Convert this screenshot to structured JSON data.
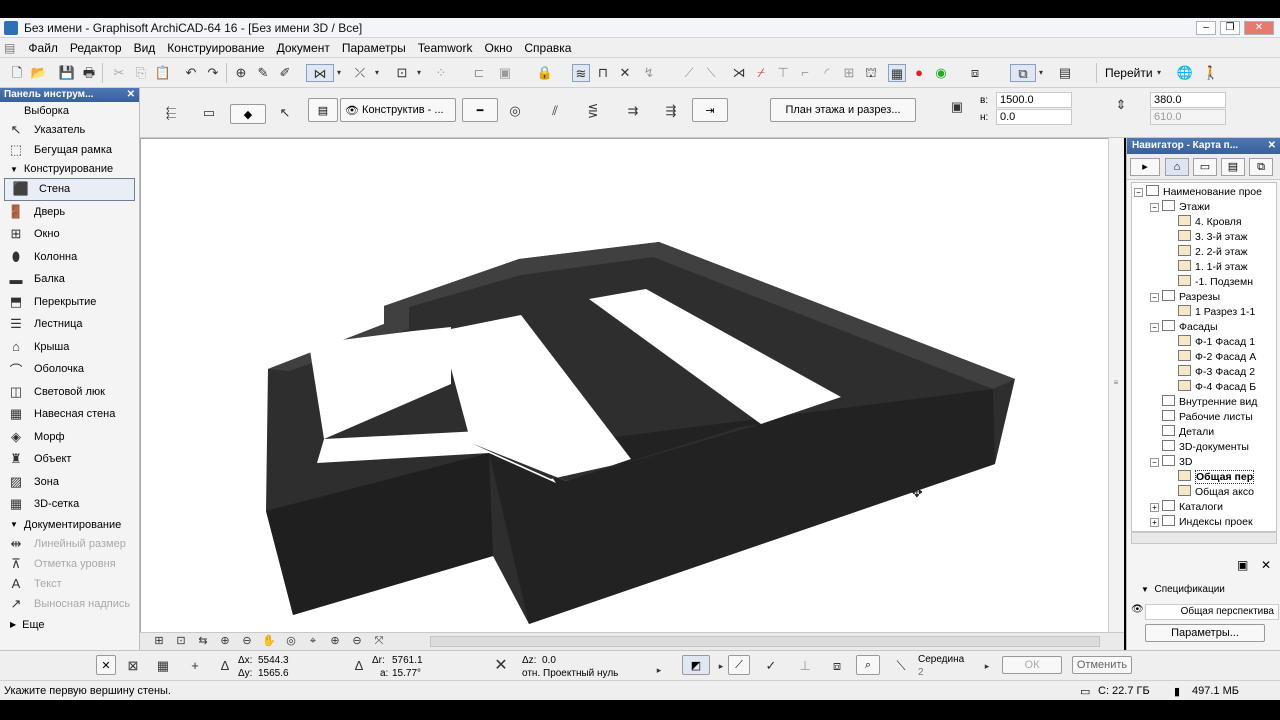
{
  "window": {
    "title": "Без имени - Graphisoft ArchiCAD-64 16 - [Без имени 3D / Все]"
  },
  "menu": [
    "Файл",
    "Редактор",
    "Вид",
    "Конструирование",
    "Документ",
    "Параметры",
    "Teamwork",
    "Окно",
    "Справка"
  ],
  "toolbar": {
    "goto_label": "Перейти"
  },
  "infobox": {
    "construct_label": "Конструктив - ...",
    "plan_button": "План этажа и разрез...",
    "b_label": "в:",
    "b_value": "1500.0",
    "n_label": "н:",
    "n_value": "0.0",
    "height_value": "380.0",
    "height2_value": "610.0"
  },
  "toolbox": {
    "title": "Панель инструм...",
    "select_section": "Выборка",
    "select_items": [
      "Указатель",
      "Бегущая рамка"
    ],
    "construct_section": "Конструирование",
    "construct_items": [
      "Стена",
      "Дверь",
      "Окно",
      "Колонна",
      "Балка",
      "Перекрытие",
      "Лестница",
      "Крыша",
      "Оболочка",
      "Световой люк",
      "Навесная стена",
      "Морф",
      "Объект",
      "Зона",
      "3D-сетка"
    ],
    "doc_section": "Документирование",
    "doc_items": [
      "Линейный размер",
      "Отметка уровня",
      "Текст",
      "Выносная надпись"
    ],
    "more_label": "Еще"
  },
  "navigator": {
    "title": "Навигатор - Карта п...",
    "tree": [
      {
        "label": "Наименование прое",
        "level": 0,
        "exp": "−"
      },
      {
        "label": "Этажи",
        "level": 1,
        "exp": "−"
      },
      {
        "label": "4. Кровля",
        "level": 2
      },
      {
        "label": "3. 3-й этаж",
        "level": 2
      },
      {
        "label": "2. 2-й этаж",
        "level": 2
      },
      {
        "label": "1. 1-й этаж",
        "level": 2
      },
      {
        "label": "-1. Подземн",
        "level": 2
      },
      {
        "label": "Разрезы",
        "level": 1,
        "exp": "−"
      },
      {
        "label": "1 Разрез 1-1",
        "level": 2
      },
      {
        "label": "Фасады",
        "level": 1,
        "exp": "−"
      },
      {
        "label": "Ф-1 Фасад 1",
        "level": 2
      },
      {
        "label": "Ф-2 Фасад А",
        "level": 2
      },
      {
        "label": "Ф-3 Фасад 2",
        "level": 2
      },
      {
        "label": "Ф-4 Фасад Б",
        "level": 2
      },
      {
        "label": "Внутренние вид",
        "level": 1
      },
      {
        "label": "Рабочие листы",
        "level": 1
      },
      {
        "label": "Детали",
        "level": 1
      },
      {
        "label": "3D-документы",
        "level": 1
      },
      {
        "label": "3D",
        "level": 1,
        "exp": "−"
      },
      {
        "label": "Общая пер",
        "level": 2,
        "bold": true
      },
      {
        "label": "Общая аксо",
        "level": 2
      },
      {
        "label": "Каталоги",
        "level": 1,
        "exp": "+"
      },
      {
        "label": "Индексы проек",
        "level": 1,
        "exp": "+"
      }
    ],
    "spec_label": "Спецификации",
    "selected_view": "Общая перспектива",
    "params_button": "Параметры..."
  },
  "coords": {
    "dx_label": "Δx:",
    "dx": "5544.3",
    "dy_label": "Δy:",
    "dy": "1565.6",
    "dr_label": "Δr:",
    "dr": "5761.1",
    "a_label": "a:",
    "a": "15.77°",
    "dz_label": "Δz:",
    "dz": "0.0",
    "ref_label": "отн. Проектный нуль"
  },
  "snap": {
    "label": "Середина",
    "value": "2"
  },
  "actions": {
    "ok": "ОК",
    "cancel": "Отменить"
  },
  "status": {
    "message": "Укажите первую вершину стены.",
    "disk": "С: 22.7 ГБ",
    "memory": "497.1 МБ"
  }
}
